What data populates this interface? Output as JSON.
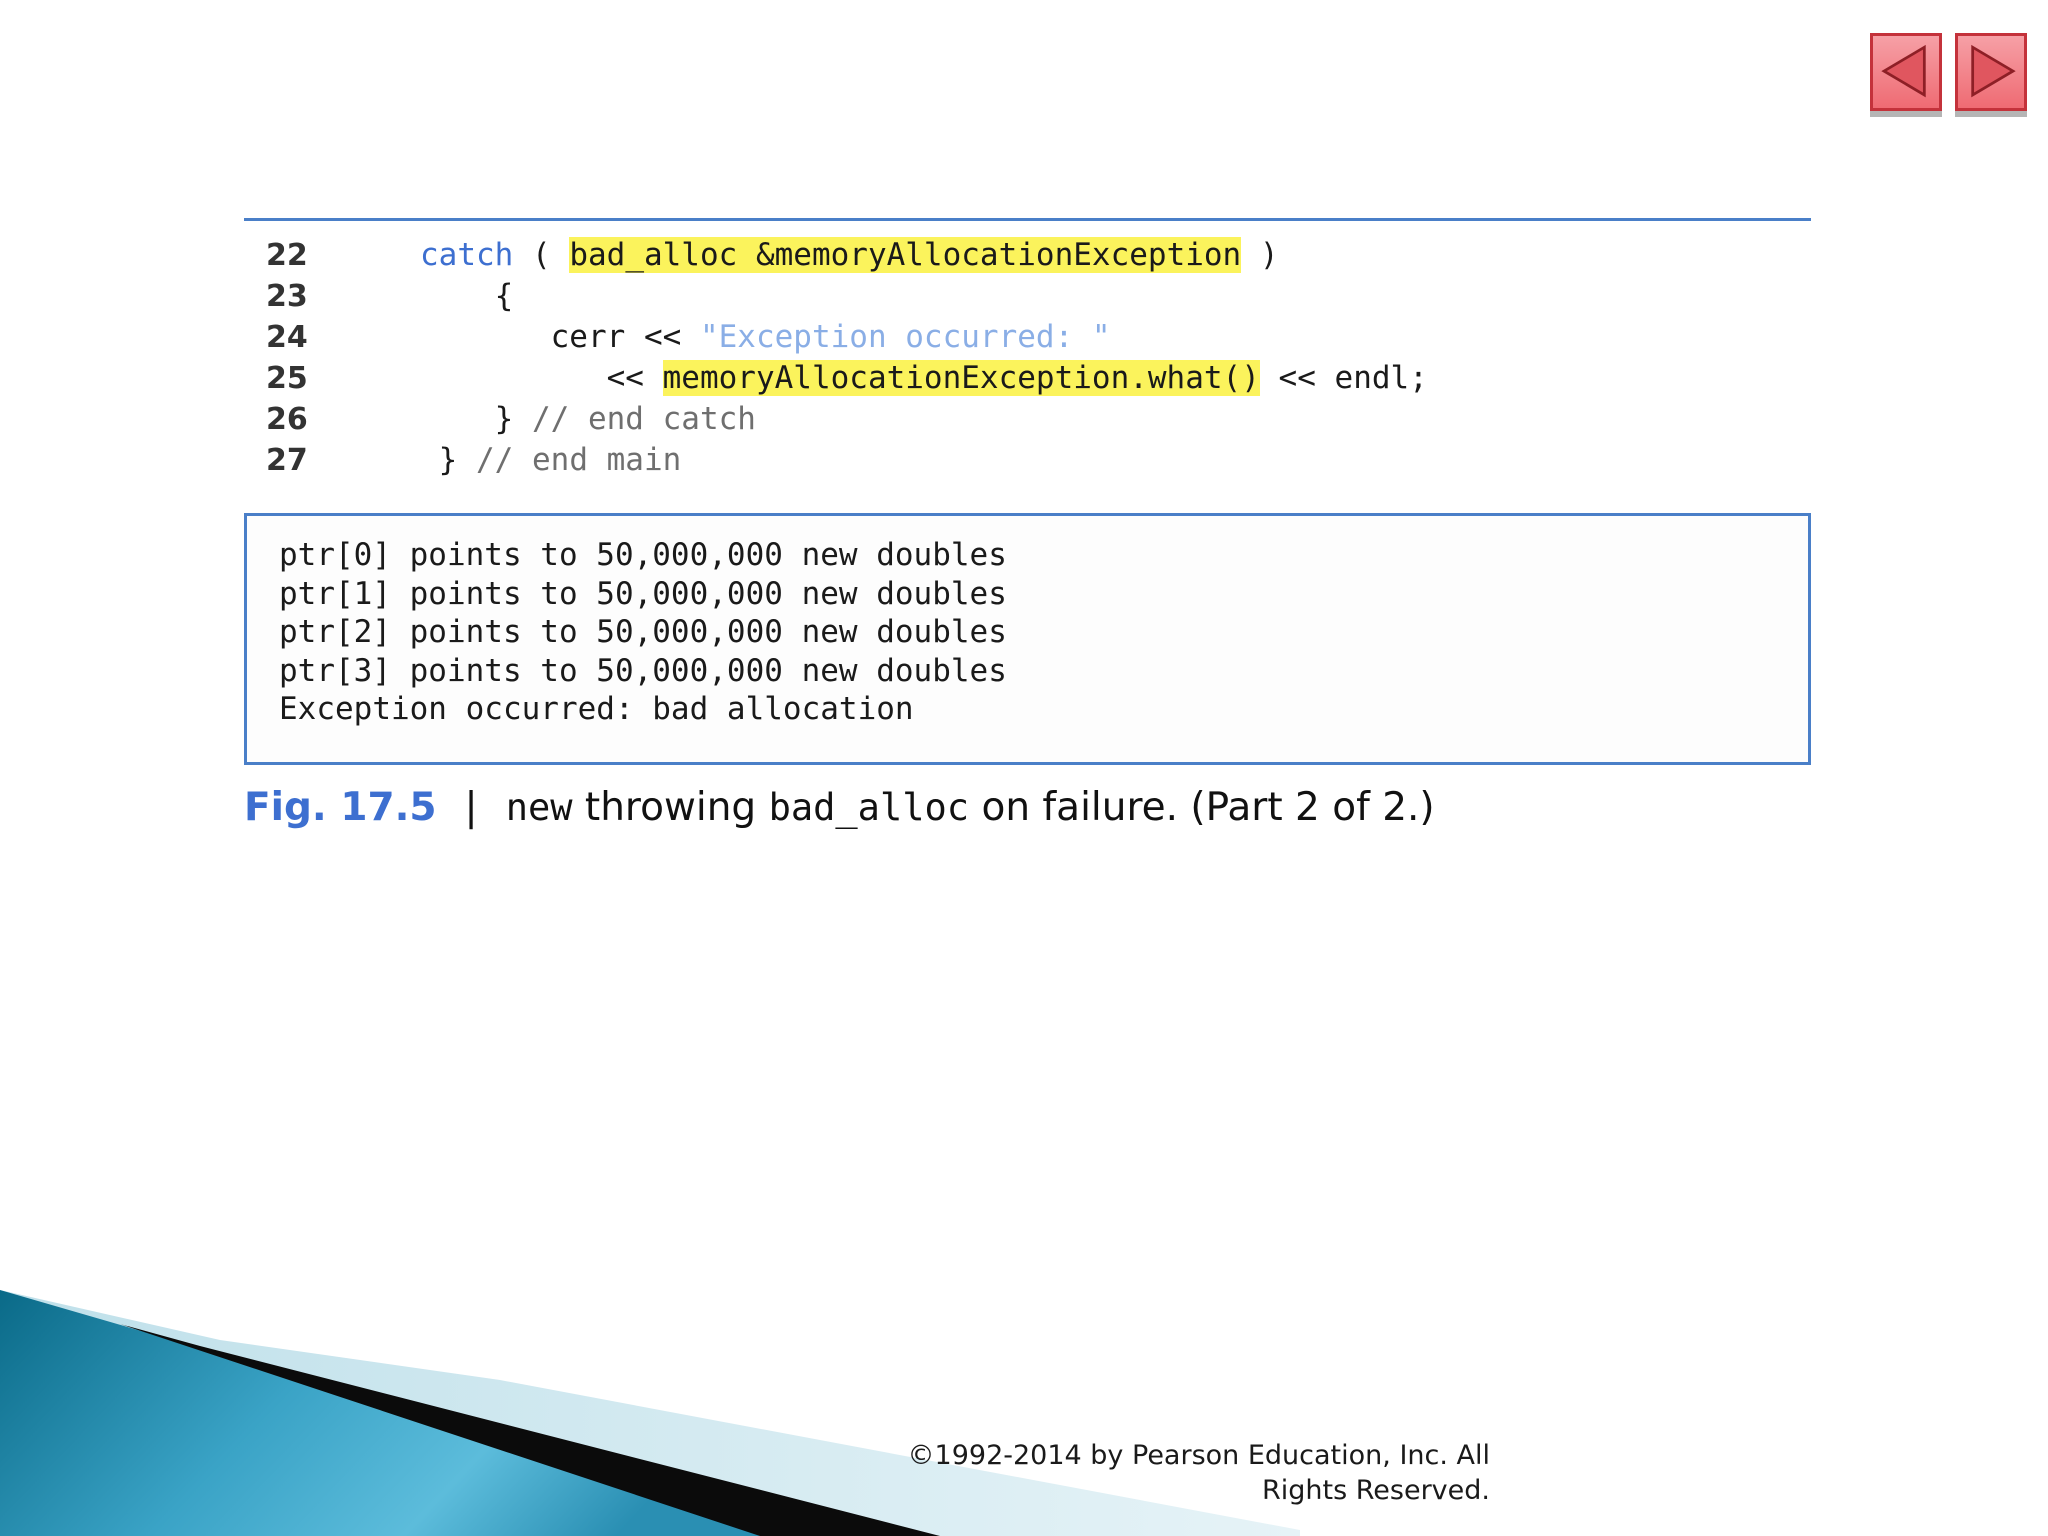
{
  "nav": {
    "prev_icon": "triangle-left-icon",
    "next_icon": "triangle-right-icon"
  },
  "code": {
    "lines": [
      {
        "num": "22",
        "indent": "    ",
        "keyword": "catch",
        "plain_a": " ( ",
        "highlight": "bad_alloc &memoryAllocationException",
        "plain_b": " )"
      },
      {
        "num": "23",
        "text": "    {"
      },
      {
        "num": "24",
        "prefix": "       cerr << ",
        "string": "\"Exception occurred: \""
      },
      {
        "num": "25",
        "prefix": "          << ",
        "highlight": "memoryAllocationException.what()",
        "suffix": " << endl;"
      },
      {
        "num": "26",
        "prefix": "    } ",
        "comment": "// end catch"
      },
      {
        "num": "27",
        "prefix": " } ",
        "comment": "// end main"
      }
    ]
  },
  "output": {
    "lines": [
      "ptr[0] points to 50,000,000 new doubles",
      "ptr[1] points to 50,000,000 new doubles",
      "ptr[2] points to 50,000,000 new doubles",
      "ptr[3] points to 50,000,000 new doubles",
      "Exception occurred: bad allocation"
    ]
  },
  "caption": {
    "fig_label": "Fig. 17.5",
    "separator": "|",
    "code_new": "new",
    "text_a": " throwing ",
    "code_bad_alloc": "bad_alloc",
    "text_b": " on failure. (Part 2 of 2.)"
  },
  "footer": {
    "copyright_line1": "©1992-2014 by Pearson Education, Inc. All",
    "copyright_line2": "Rights Reserved."
  },
  "colors": {
    "accent_blue": "#3d6fd0",
    "highlight_yellow": "#fbf35c",
    "nav_red": "#ef6b73"
  }
}
